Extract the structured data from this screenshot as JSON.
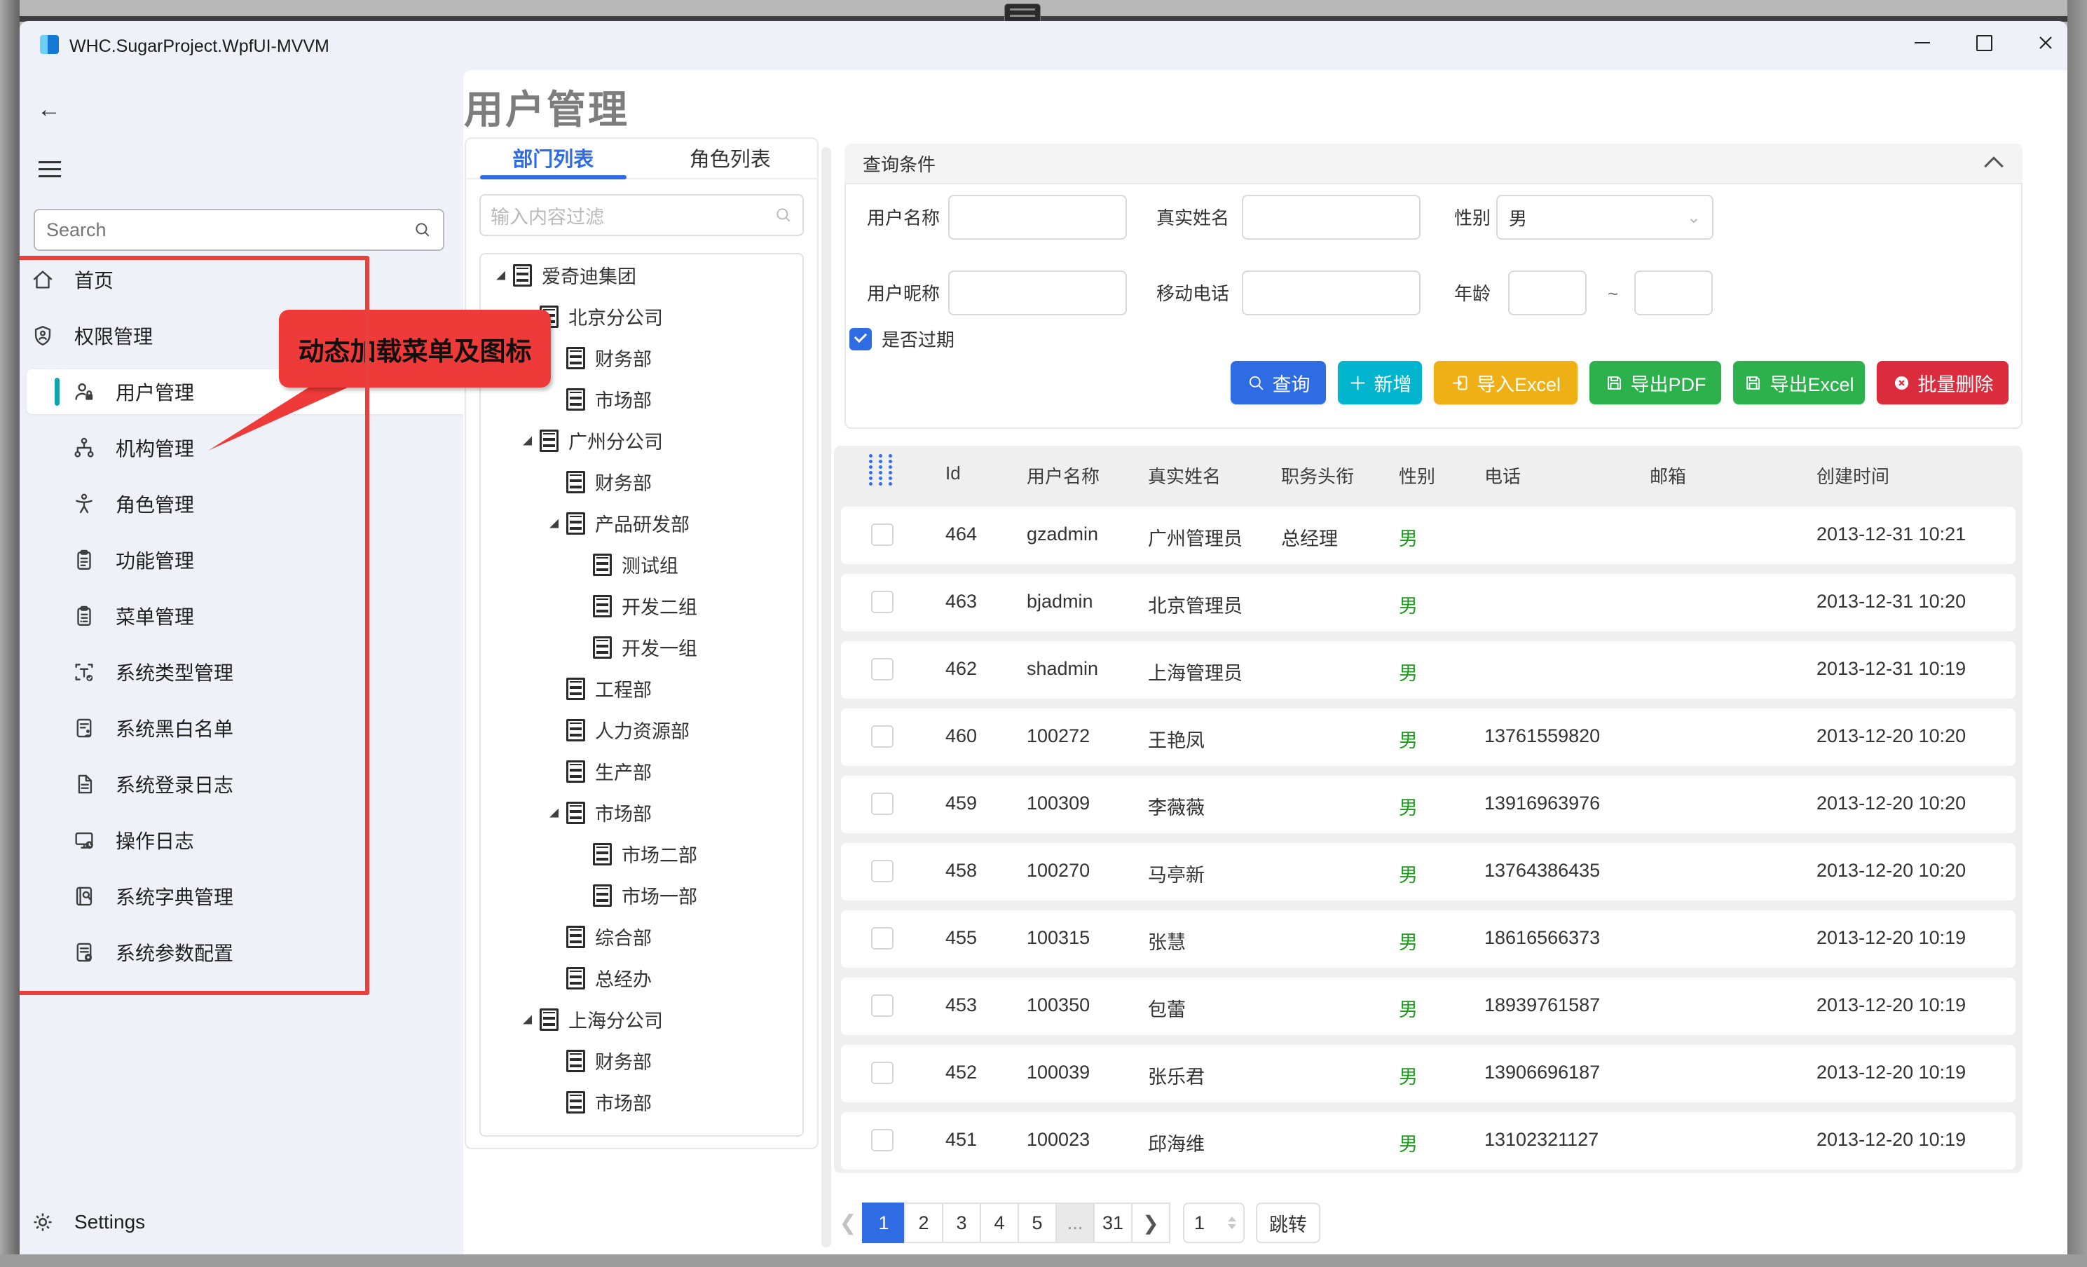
{
  "window": {
    "title": "WHC.SugarProject.WpfUI-MVVM",
    "controls": [
      {
        "name": "minimize",
        "icon": "minimize-icon"
      },
      {
        "name": "maximize",
        "icon": "maximize-icon"
      },
      {
        "name": "close",
        "icon": "close-icon"
      }
    ]
  },
  "colors": {
    "accent_blue": "#2f6be3",
    "selected_teal": "#16a3ad",
    "gender_green": "#18a018",
    "callout_red": "#ee3a38",
    "title_gray": "#7d7d7d"
  },
  "sidebar": {
    "back_icon": "back-arrow-icon",
    "menu_icon": "hamburger-icon",
    "search_placeholder": "Search",
    "items": [
      {
        "label": "首页",
        "icon": "home-icon",
        "indent": 0,
        "selected": false
      },
      {
        "label": "权限管理",
        "icon": "shield-person-icon",
        "indent": 0,
        "selected": false
      },
      {
        "label": "用户管理",
        "icon": "user-lock-icon",
        "indent": 1,
        "selected": true
      },
      {
        "label": "机构管理",
        "icon": "org-chart-icon",
        "indent": 1,
        "selected": false
      },
      {
        "label": "角色管理",
        "icon": "role-person-icon",
        "indent": 1,
        "selected": false
      },
      {
        "label": "功能管理",
        "icon": "clipboard-icon",
        "indent": 1,
        "selected": false
      },
      {
        "label": "菜单管理",
        "icon": "clipboard-list-icon",
        "indent": 1,
        "selected": false
      },
      {
        "label": "系统类型管理",
        "icon": "type-scan-icon",
        "indent": 1,
        "selected": false
      },
      {
        "label": "系统黑白名单",
        "icon": "list-person-icon",
        "indent": 1,
        "selected": false
      },
      {
        "label": "系统登录日志",
        "icon": "document-icon",
        "indent": 1,
        "selected": false
      },
      {
        "label": "操作日志",
        "icon": "monitor-clock-icon",
        "indent": 1,
        "selected": false
      },
      {
        "label": "系统字典管理",
        "icon": "book-search-icon",
        "indent": 1,
        "selected": false
      },
      {
        "label": "系统参数配置",
        "icon": "doc-gear-icon",
        "indent": 1,
        "selected": false
      }
    ],
    "settings_label": "Settings",
    "settings_icon": "gear-icon",
    "callout_text": "动态加载菜单及图标"
  },
  "page": {
    "title": "用户管理"
  },
  "tabs": [
    {
      "label": "部门列表",
      "active": true
    },
    {
      "label": "角色列表",
      "active": false
    }
  ],
  "tree": {
    "filter_placeholder": "输入内容过滤",
    "filter_icon": "search-icon",
    "node_icon": "document-lines-icon",
    "nodes": [
      {
        "label": "爱奇迪集团",
        "level": 0,
        "expanded": true
      },
      {
        "label": "北京分公司",
        "level": 1,
        "expanded": true
      },
      {
        "label": "财务部",
        "level": 2,
        "expanded": false
      },
      {
        "label": "市场部",
        "level": 2,
        "expanded": false
      },
      {
        "label": "广州分公司",
        "level": 1,
        "expanded": true
      },
      {
        "label": "财务部",
        "level": 2,
        "expanded": false
      },
      {
        "label": "产品研发部",
        "level": 2,
        "expanded": true
      },
      {
        "label": "测试组",
        "level": 3,
        "expanded": false
      },
      {
        "label": "开发二组",
        "level": 3,
        "expanded": false
      },
      {
        "label": "开发一组",
        "level": 3,
        "expanded": false
      },
      {
        "label": "工程部",
        "level": 2,
        "expanded": false
      },
      {
        "label": "人力资源部",
        "level": 2,
        "expanded": false
      },
      {
        "label": "生产部",
        "level": 2,
        "expanded": false
      },
      {
        "label": "市场部",
        "level": 2,
        "expanded": true
      },
      {
        "label": "市场二部",
        "level": 3,
        "expanded": false
      },
      {
        "label": "市场一部",
        "level": 3,
        "expanded": false
      },
      {
        "label": "综合部",
        "level": 2,
        "expanded": false
      },
      {
        "label": "总经办",
        "level": 2,
        "expanded": false
      },
      {
        "label": "上海分公司",
        "level": 1,
        "expanded": true
      },
      {
        "label": "财务部",
        "level": 2,
        "expanded": false
      },
      {
        "label": "市场部",
        "level": 2,
        "expanded": false
      }
    ]
  },
  "query": {
    "header": "查询条件",
    "collapse_icon": "chevron-up-icon",
    "fields": {
      "username_label": "用户名称",
      "realname_label": "真实姓名",
      "gender_label": "性别",
      "gender_value": "男",
      "nickname_label": "用户昵称",
      "mobile_label": "移动电话",
      "age_label": "年龄",
      "age_separator": "~"
    },
    "expire_checkbox_label": "是否过期",
    "expire_checked": true,
    "buttons": [
      {
        "label": "查询",
        "color": "#2f6be3",
        "icon": "search-icon"
      },
      {
        "label": "新增",
        "color": "#02b5cf",
        "icon": "plus-icon"
      },
      {
        "label": "导入Excel",
        "color": "#eeb014",
        "icon": "import-icon"
      },
      {
        "label": "导出PDF",
        "color": "#2cb14d",
        "icon": "save-icon"
      },
      {
        "label": "导出Excel",
        "color": "#2cb14d",
        "icon": "save-icon"
      },
      {
        "label": "批量删除",
        "color": "#da2c3d",
        "icon": "x-circle-icon"
      }
    ]
  },
  "table": {
    "drag_icon": "drag-grid-icon",
    "columns": [
      "Id",
      "用户名称",
      "真实姓名",
      "职务头衔",
      "性别",
      "电话",
      "邮箱",
      "创建时间"
    ],
    "rows": [
      {
        "id": "464",
        "username": "gzadmin",
        "realname": "广州管理员",
        "title": "总经理",
        "gender": "男",
        "phone": "",
        "email": "",
        "created": "2013-12-31 10:21"
      },
      {
        "id": "463",
        "username": "bjadmin",
        "realname": "北京管理员",
        "title": "",
        "gender": "男",
        "phone": "",
        "email": "",
        "created": "2013-12-31 10:20"
      },
      {
        "id": "462",
        "username": "shadmin",
        "realname": "上海管理员",
        "title": "",
        "gender": "男",
        "phone": "",
        "email": "",
        "created": "2013-12-31 10:19"
      },
      {
        "id": "460",
        "username": "100272",
        "realname": "王艳凤",
        "title": "",
        "gender": "男",
        "phone": "13761559820",
        "email": "",
        "created": "2013-12-20 10:20"
      },
      {
        "id": "459",
        "username": "100309",
        "realname": "李薇薇",
        "title": "",
        "gender": "男",
        "phone": "13916963976",
        "email": "",
        "created": "2013-12-20 10:20"
      },
      {
        "id": "458",
        "username": "100270",
        "realname": "马亭新",
        "title": "",
        "gender": "男",
        "phone": "13764386435",
        "email": "",
        "created": "2013-12-20 10:20"
      },
      {
        "id": "455",
        "username": "100315",
        "realname": "张慧",
        "title": "",
        "gender": "男",
        "phone": "18616566373",
        "email": "",
        "created": "2013-12-20 10:19"
      },
      {
        "id": "453",
        "username": "100350",
        "realname": "包蕾",
        "title": "",
        "gender": "男",
        "phone": "18939761587",
        "email": "",
        "created": "2013-12-20 10:19"
      },
      {
        "id": "452",
        "username": "100039",
        "realname": "张乐君",
        "title": "",
        "gender": "男",
        "phone": "13906696187",
        "email": "",
        "created": "2013-12-20 10:19"
      },
      {
        "id": "451",
        "username": "100023",
        "realname": "邱海维",
        "title": "",
        "gender": "男",
        "phone": "13102321127",
        "email": "",
        "created": "2013-12-20 10:19"
      }
    ]
  },
  "pagination": {
    "prev_icon": "chevron-left-icon",
    "next_icon": "chevron-right-icon",
    "pages": [
      "1",
      "2",
      "3",
      "4",
      "5",
      "...",
      "31"
    ],
    "active_page": "1",
    "jump_value": "1",
    "jump_label": "跳转"
  }
}
